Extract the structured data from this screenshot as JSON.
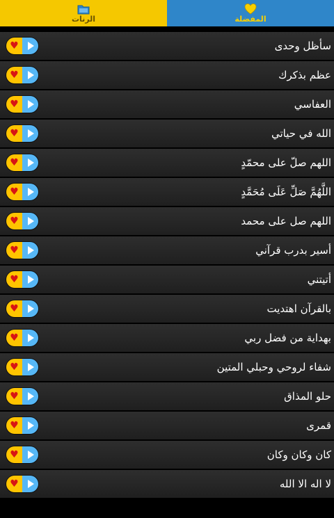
{
  "tabs": {
    "tones": {
      "label": "الرنات",
      "icon": "folder-icon"
    },
    "favorites": {
      "label": "المفضلة",
      "icon": "heart-icon"
    }
  },
  "colors": {
    "tones_tab_bg": "#f5c800",
    "favorites_tab_bg": "#2f86c9",
    "favorite_button": "#ffc400",
    "play_button": "#56b7f6",
    "heart": "#d81414"
  },
  "items": [
    {
      "title": "سأظل وحدى"
    },
    {
      "title": "عظم بذكرك"
    },
    {
      "title": "العفاسي"
    },
    {
      "title": "الله في حياتي"
    },
    {
      "title": "اللهم صلّ على محمّدٍ"
    },
    {
      "title": "اللَّهُمَّ صَلِّ عَلَى مُحَمَّدٍ"
    },
    {
      "title": "اللهم صل على محمد"
    },
    {
      "title": "أسير بدرب قرآني"
    },
    {
      "title": "أتيتني"
    },
    {
      "title": "بالقرآن اهتديت"
    },
    {
      "title": "بهداية من فضل ربي"
    },
    {
      "title": "شفاء لروحي وحبلي المتين"
    },
    {
      "title": "حلو المذاق"
    },
    {
      "title": "قمرى"
    },
    {
      "title": "كان وكان وكان"
    },
    {
      "title": "لا اله الا الله"
    }
  ]
}
